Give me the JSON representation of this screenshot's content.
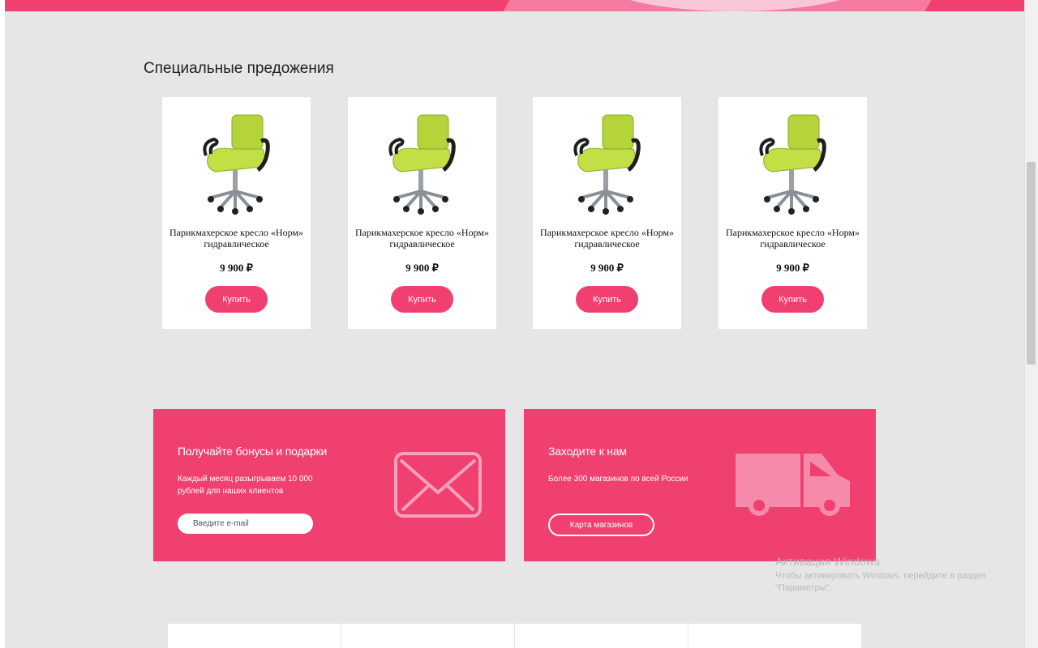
{
  "section": {
    "title": "Специальные предожения"
  },
  "products": [
    {
      "name": "Парикмахерское кресло «Норм» гидравлическое",
      "price": "9 900 ₽",
      "buy_label": "Купить"
    },
    {
      "name": "Парикмахерское кресло «Норм» гидравлическое",
      "price": "9 900 ₽",
      "buy_label": "Купить"
    },
    {
      "name": "Парикмахерское кресло «Норм» гидравлическое",
      "price": "9 900 ₽",
      "buy_label": "Купить"
    },
    {
      "name": "Парикмахерское кресло «Норм» гидравлическое",
      "price": "9 900 ₽",
      "buy_label": "Купить"
    }
  ],
  "promo_bonus": {
    "title": "Получайте бонусы и подарки",
    "text": "Каждый месяц разыгрываем 10 000 рублей для наших клиентов",
    "email_placeholder": "Введите e-mail",
    "icon": "envelope-icon"
  },
  "promo_stores": {
    "title": "Заходите к нам",
    "text": "Более 300 магазинов по всей России",
    "button_label": "Карта магазинов",
    "icon": "truck-icon"
  },
  "watermark": {
    "line1": "Активация Windows",
    "line2": "Чтобы активировать Windows, перейдите в раздел",
    "line3": "\"Параметры\"."
  },
  "colors": {
    "accent": "#f0406f",
    "background": "#e6e6e6",
    "card": "#ffffff"
  }
}
